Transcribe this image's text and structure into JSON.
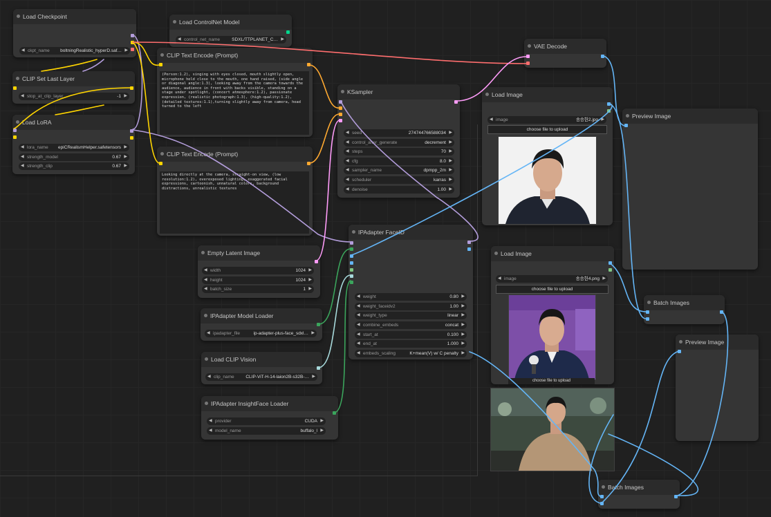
{
  "colors": {
    "canvas": "#202020",
    "node_bg": "#353535",
    "model": "#b39ddb",
    "clip": "#ffd500",
    "vae": "#ff6e6e",
    "conditioning": "#ffa931",
    "latent": "#ff9cf9",
    "image": "#64b5f6",
    "control_net": "#00d78d",
    "ipadapter": "#3ba55c",
    "clip_vision": "#a8dadc"
  },
  "nodes": {
    "load_checkpoint": {
      "title": "Load Checkpoint",
      "ckpt_label": "ckpt_name",
      "ckpt_value": "boltningRealistic_hyperD.saf…"
    },
    "load_controlnet": {
      "title": "Load ControlNet Model",
      "cn_label": "control_net_name",
      "cn_value": "SDXL/TTPLANET_C…"
    },
    "clip_set_last_layer": {
      "title": "CLIP Set Last Layer",
      "layer_label": "stop_at_clip_layer",
      "layer_value": "-1"
    },
    "load_lora": {
      "title": "Load LoRA",
      "lora_label": "lora_name",
      "lora_value": "epiCRealismHelper.safetensors",
      "sm_label": "strength_model",
      "sm_value": "0.67",
      "sc_label": "strength_clip",
      "sc_value": "0.67"
    },
    "clip_text_pos": {
      "title": "CLIP Text Encode (Prompt)",
      "text": "(Person:1.2), singing with eyes closed, mouth slightly open, microphone held close to the mouth, one hand raised, (side angle or diagonal angle:1.3), looking away from the camera towards the audience, audience in front with backs visible, standing on a stage under spotlight, (concert atmosphere:1.2), passionate expression, (realistic photograph:1.3), (high-quality:1.2), (detailed textures:1.1),turning slightly away from camera, head turned to the left"
    },
    "clip_text_neg": {
      "title": "CLIP Text Encode (Prompt)",
      "text": "Looking directly at the camera, straight-on view, (low resolution:1.2), overexposed lighting, exaggerated facial expressions, cartoonish, unnatural colors, background distractions, unrealistic textures"
    },
    "ksampler": {
      "title": "KSampler",
      "seed_label": "seed",
      "seed_value": "274744766588034",
      "cag_label": "control_after_generate",
      "cag_value": "decrement",
      "steps_label": "steps",
      "steps_value": "70",
      "cfg_label": "cfg",
      "cfg_value": "8.0",
      "sampler_label": "sampler_name",
      "sampler_value": "dpmpp_2m",
      "scheduler_label": "scheduler",
      "scheduler_value": "karras",
      "denoise_label": "denoise",
      "denoise_value": "1.00"
    },
    "vae_decode": {
      "title": "VAE Decode"
    },
    "load_image_1": {
      "title": "Load Image",
      "image_label": "image",
      "image_value": "송승헌2.jpg",
      "upload_label": "choose file to upload"
    },
    "preview_image_1": {
      "title": "Preview Image"
    },
    "empty_latent": {
      "title": "Empty Latent Image",
      "width_label": "width",
      "width_value": "1024",
      "height_label": "height",
      "height_value": "1024",
      "batch_label": "batch_size",
      "batch_value": "1"
    },
    "ipadapter_faceid": {
      "title": "IPAdapter FaceID",
      "weight_label": "weight",
      "weight_value": "0.80",
      "wfv2_label": "weight_faceidv2",
      "wfv2_value": "1.00",
      "wtype_label": "weight_type",
      "wtype_value": "linear",
      "combine_label": "combine_embeds",
      "combine_value": "concat",
      "start_label": "start_at",
      "start_value": "0.100",
      "end_label": "end_at",
      "end_value": "1.000",
      "scaling_label": "embeds_scaling",
      "scaling_value": "K+mean(V) w/ C penalty"
    },
    "ipadapter_model_loader": {
      "title": "IPAdapter Model Loader",
      "file_label": "ipadapter_file",
      "file_value": "ip-adapter-plus-face_sdxl…"
    },
    "load_clip_vision": {
      "title": "Load CLIP Vision",
      "clip_label": "clip_name",
      "clip_value": "CLIP-ViT-H-14-laion2B-s32B-…"
    },
    "insightface_loader": {
      "title": "IPAdapter InsightFace Loader",
      "provider_label": "provider",
      "provider_value": "CUDA",
      "model_label": "model_name",
      "model_value": "buffalo_l"
    },
    "load_image_2": {
      "title": "Load Image",
      "image_label": "image",
      "image_value": "송승헌4.png",
      "upload_label": "choose file to upload",
      "upload_overlap_label": "choose file to upload"
    },
    "batch_images_1": {
      "title": "Batch Images"
    },
    "preview_image_2": {
      "title": "Preview Image"
    },
    "batch_images_2": {
      "title": "Batch Images"
    }
  }
}
